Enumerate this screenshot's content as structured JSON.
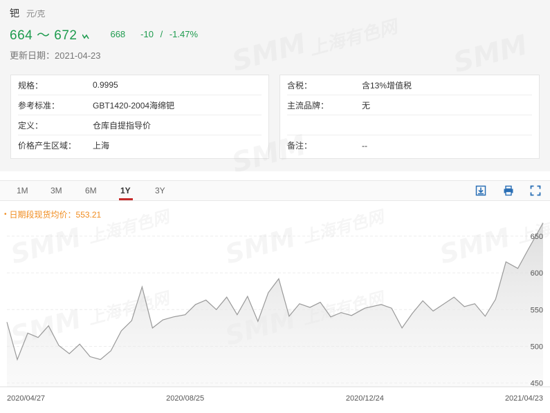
{
  "header": {
    "name": "钯",
    "unit": "元/克",
    "price_range": "664 ～ 672",
    "avg_price": "668",
    "change_abs": "-10",
    "change_sep": "/",
    "change_pct": "-1.47%",
    "update_label": "更新日期：",
    "update_date": "2021-04-23",
    "colors": {
      "down": "#1e9b4e",
      "accent": "#c62a2a",
      "legend": "#f08c1f"
    }
  },
  "specs_left": [
    {
      "label": "规格：",
      "value": "0.9995"
    },
    {
      "label": "参考标准：",
      "value": "GBT1420-2004海绵钯"
    },
    {
      "label": "定义：",
      "value": "仓库自提指导价"
    },
    {
      "label": "价格产生区域：",
      "value": "上海"
    }
  ],
  "specs_right": [
    {
      "label": "含税：",
      "value": "含13%增值税"
    },
    {
      "label": "主流品牌：",
      "value": "无"
    },
    {
      "label": "",
      "value": ""
    },
    {
      "label": "备注：",
      "value": "--"
    }
  ],
  "tabs": [
    {
      "label": "1M"
    },
    {
      "label": "3M"
    },
    {
      "label": "6M"
    },
    {
      "label": "1Y",
      "active": true
    },
    {
      "label": "3Y"
    }
  ],
  "toolbar": {
    "download_icon": "download-icon",
    "print_icon": "print-icon",
    "fullscreen_icon": "fullscreen-icon"
  },
  "watermark": {
    "brand": "SMM",
    "text": "上海有色网"
  },
  "chart_data": {
    "type": "area",
    "legend": "日期段现货均价：553.21",
    "x_ticks": [
      "2020/04/27",
      "2020/08/25",
      "2020/12/24",
      "2021/04/23"
    ],
    "y_ticks": [
      450,
      500,
      550,
      600,
      650
    ],
    "ylim": [
      445,
      680
    ],
    "grid": true,
    "series": [
      {
        "x": [
          "2020/04/27",
          "2020/05/04",
          "2020/05/11",
          "2020/05/18",
          "2020/05/25",
          "2020/06/01",
          "2020/06/08",
          "2020/06/15",
          "2020/06/22",
          "2020/06/29",
          "2020/07/06",
          "2020/07/13",
          "2020/07/20",
          "2020/07/27",
          "2020/08/03",
          "2020/08/10",
          "2020/08/17",
          "2020/08/25",
          "2020/09/01",
          "2020/09/08",
          "2020/09/15",
          "2020/09/22",
          "2020/09/29",
          "2020/10/06",
          "2020/10/13",
          "2020/10/20",
          "2020/10/27",
          "2020/11/03",
          "2020/11/10",
          "2020/11/17",
          "2020/11/24",
          "2020/12/01",
          "2020/12/08",
          "2020/12/15",
          "2020/12/24",
          "2021/01/04",
          "2021/01/11",
          "2021/01/18",
          "2021/01/25",
          "2021/02/01",
          "2021/02/08",
          "2021/02/22",
          "2021/03/01",
          "2021/03/08",
          "2021/03/15",
          "2021/03/22",
          "2021/03/29",
          "2021/04/06",
          "2021/04/13",
          "2021/04/23"
        ],
        "values": [
          533,
          482,
          518,
          512,
          528,
          501,
          490,
          503,
          486,
          482,
          494,
          521,
          535,
          581,
          525,
          536,
          540,
          543,
          557,
          563,
          550,
          567,
          543,
          568,
          534,
          573,
          592,
          541,
          558,
          553,
          560,
          540,
          546,
          542,
          552,
          557,
          552,
          525,
          545,
          562,
          548,
          567,
          554,
          558,
          541,
          564,
          615,
          606,
          632,
          668
        ]
      }
    ]
  }
}
